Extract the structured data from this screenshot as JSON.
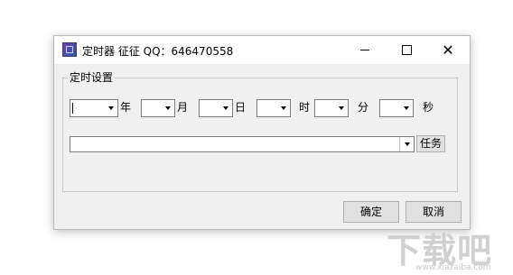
{
  "window": {
    "title": "定时器 征征 QQ：646470558",
    "controls": {
      "minimize": "minimize",
      "maximize": "maximize",
      "close": "✕"
    }
  },
  "group": {
    "label": "定时设置"
  },
  "units": {
    "year": "年",
    "month": "月",
    "day": "日",
    "hour": "时",
    "minute": "分",
    "second": "秒"
  },
  "fields": {
    "year": "",
    "month": "",
    "day": "",
    "hour": "",
    "minute": "",
    "second": "",
    "task": ""
  },
  "buttons": {
    "task": "任务",
    "ok": "确定",
    "cancel": "取消"
  },
  "watermark": {
    "brand": "下载吧",
    "url": "www.xiazaiba.com"
  }
}
